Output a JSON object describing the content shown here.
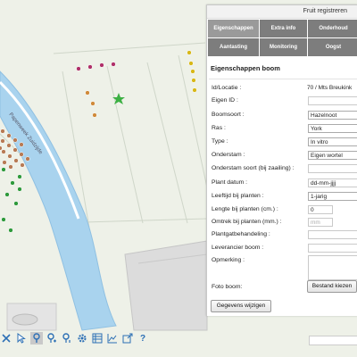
{
  "map": {
    "road_label": "Papenweek Zuidzijde"
  },
  "panel": {
    "title": "Fruit registreren",
    "tabs": [
      "Eigenschappen",
      "Extra info",
      "Onderhoud",
      "",
      "Aantasting",
      "Monitoring",
      "Oogst",
      ""
    ],
    "section_title": "Eigenschappen boom",
    "labels": {
      "id": "Id/Locatie :",
      "eigen_id": "Eigen ID :",
      "boomsoort": "Boomsoort :",
      "ras": "Ras :",
      "type": "Type :",
      "onderstam": "Onderstam :",
      "onderstam_soort": "Onderstam soort (bij zaailing) :",
      "plant_datum": "Plant datum :",
      "leeftijd": "Leeftijd bij planten :",
      "lengte": "Lengte bij planten (cm.) :",
      "omtrek": "Omtrek bij planten (mm.) :",
      "plantgat": "Plantgatbehandeling :",
      "leverancier": "Leverancier boom :",
      "opmerking": "Opmerking :",
      "foto": "Foto boom:"
    },
    "values": {
      "id": "70 / Mts Breukink",
      "eigen_id": "",
      "boomsoort": "Hazelnoot",
      "ras": "York",
      "type": "In vitro",
      "onderstam": "Eigen wortel",
      "onderstam_soort": "",
      "plant_datum": "dd-mm-jjjj",
      "leeftijd": "1-jarig",
      "lengte": "0",
      "omtrek_placeholder": "mm",
      "plantgat": "",
      "leverancier": "",
      "opmerking": ""
    },
    "file_button": "Bestand kiezen",
    "save_button": "Gegevens wijzigen"
  },
  "toolbar": {
    "icons": [
      "close-icon",
      "cursor-icon",
      "tree-marker-icon",
      "add-tree-icon",
      "tree-info-icon",
      "settings-icon",
      "list-icon",
      "chart-icon",
      "export-icon",
      "help-icon"
    ],
    "help_label": "?"
  },
  "colors": {
    "map_bg": "#eef1e8",
    "river": "#a9d3ee",
    "tab": "#7d7d7d",
    "accent": "#2c6fb5"
  }
}
